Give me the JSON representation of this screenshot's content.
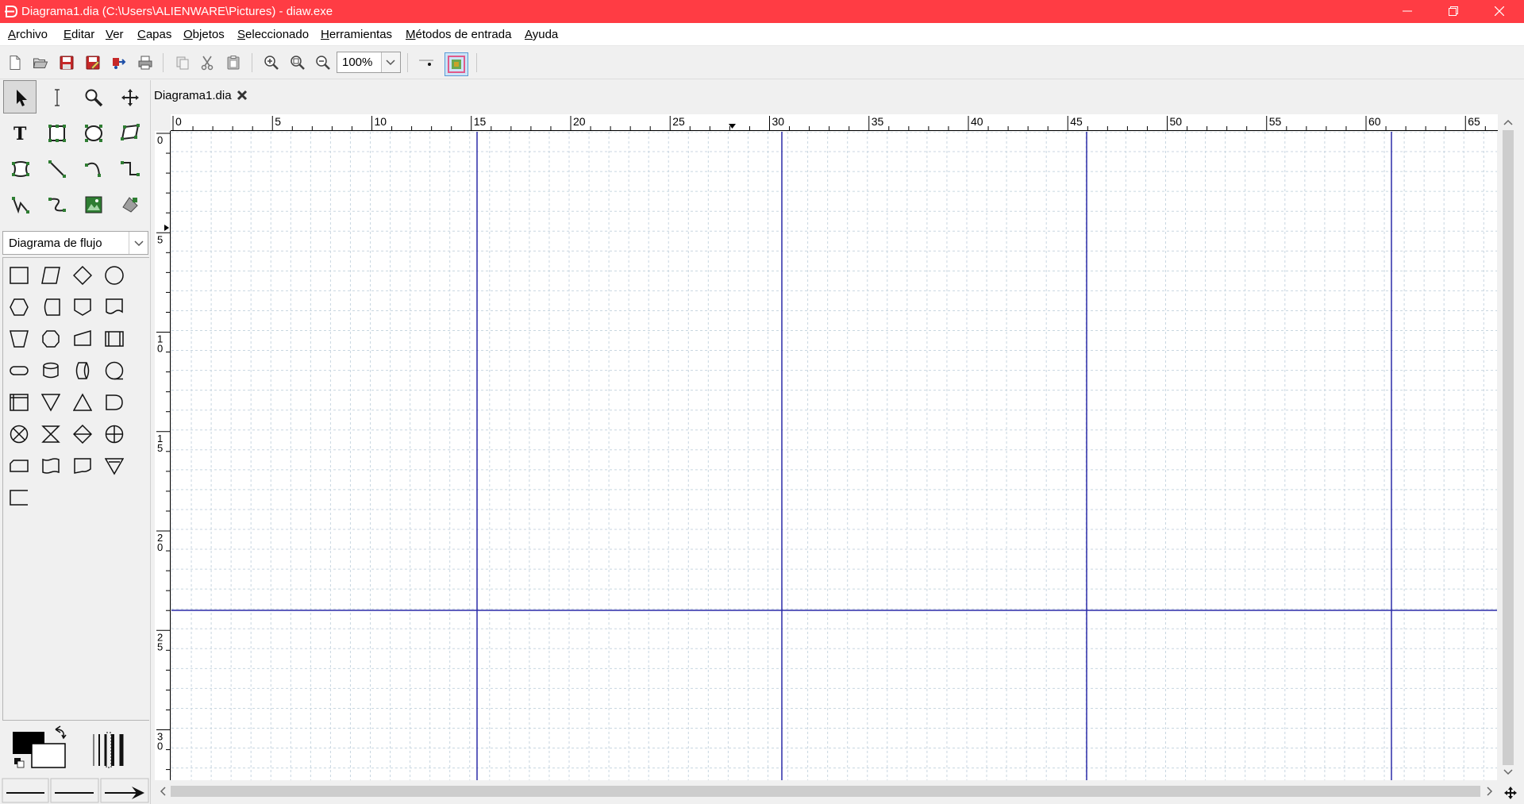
{
  "window": {
    "title": "Diagrama1.dia (C:\\Users\\ALIENWARE\\Pictures) - diaw.exe",
    "accent_color": "#ff3c44"
  },
  "menu": {
    "items": [
      {
        "label": "Archivo"
      },
      {
        "label": "Editar"
      },
      {
        "label": "Ver"
      },
      {
        "label": "Capas"
      },
      {
        "label": "Objetos"
      },
      {
        "label": "Seleccionado"
      },
      {
        "label": "Herramientas"
      },
      {
        "label": "Métodos de entrada"
      },
      {
        "label": "Ayuda"
      }
    ]
  },
  "toolbar": {
    "zoom_value": "100%",
    "icons": [
      "new-file-icon",
      "open-file-icon",
      "save-icon",
      "save-as-icon",
      "export-icon",
      "print-icon",
      "copy-icon",
      "cut-icon",
      "paste-icon",
      "zoom-in-icon",
      "zoom-fit-icon",
      "zoom-out-icon",
      "snap-to-grid-icon",
      "snap-to-objects-icon"
    ]
  },
  "toolbox": {
    "tools": [
      "pointer-tool-icon",
      "text-cursor-tool-icon",
      "magnify-tool-icon",
      "scroll-tool-icon",
      "text-tool-icon",
      "box-tool-icon",
      "ellipse-tool-icon",
      "polygon-tool-icon",
      "beziergon-tool-icon",
      "line-tool-icon",
      "arc-tool-icon",
      "zigzag-line-tool-icon",
      "polyline-tool-icon",
      "bezier-line-tool-icon",
      "image-tool-icon",
      "outline-tool-icon"
    ],
    "sheet_name": "Diagrama de flujo",
    "shapes": [
      "process-shape-icon",
      "data-shape-icon",
      "decision-shape-icon",
      "connector-shape-icon",
      "preparation-shape-icon",
      "punched-card-shape-icon",
      "offpage-connector-shape-icon",
      "document-shape-icon",
      "manual-operation-shape-icon",
      "terminal-hexagon-shape-icon",
      "punched-tape-shape-icon",
      "predefined-process-shape-icon",
      "terminator-shape-icon",
      "magnetic-disk-shape-icon",
      "direct-access-storage-shape-icon",
      "sequential-storage-shape-icon",
      "internal-storage-shape-icon",
      "merge-shape-icon",
      "extract-shape-icon",
      "delay-shape-icon",
      "summing-junction-shape-icon",
      "collate-shape-icon",
      "sort-shape-icon",
      "or-shape-icon",
      "rounded-process-shape-icon",
      "transaction-file-shape-icon",
      "online-storage-shape-icon",
      "offline-storage-shape-icon",
      "annotation-shape-icon"
    ]
  },
  "document": {
    "tab_label": "Diagrama1.dia"
  },
  "rulers": {
    "horizontal_labels": [
      "0",
      "5",
      "10",
      "15",
      "20",
      "25",
      "30",
      "35",
      "40",
      "45",
      "50",
      "55",
      "60",
      "65"
    ],
    "vertical_labels": [
      "0",
      "5",
      "10",
      "15",
      "20",
      "25",
      "30"
    ]
  },
  "canvas": {
    "grid_color": "#c8d6e0",
    "page_break_color": "#2b2ba8"
  }
}
